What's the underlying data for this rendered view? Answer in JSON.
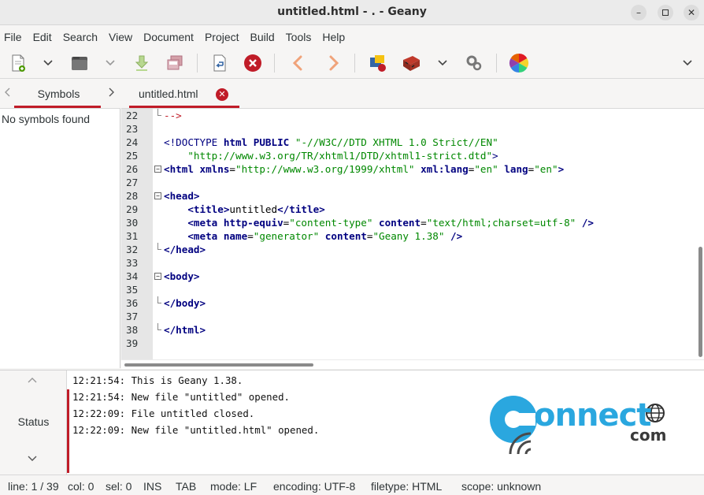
{
  "window": {
    "title": "untitled.html - . - Geany"
  },
  "menu": [
    "File",
    "Edit",
    "Search",
    "View",
    "Document",
    "Project",
    "Build",
    "Tools",
    "Help"
  ],
  "sidebar": {
    "tab_label": "Symbols",
    "empty_text": "No symbols found"
  },
  "editor": {
    "tab_label": "untitled.html",
    "lines": [
      {
        "n": "22",
        "parts": [
          {
            "c": "t-cmt",
            "t": "-->"
          }
        ],
        "fold": "end"
      },
      {
        "n": "23",
        "parts": []
      },
      {
        "n": "24",
        "parts": [
          {
            "c": "t-doc",
            "t": "<!DOCTYPE "
          },
          {
            "c": "t-attr",
            "t": "html"
          },
          {
            "c": "t-txt",
            "t": " "
          },
          {
            "c": "t-attr",
            "t": "PUBLIC"
          },
          {
            "c": "t-txt",
            "t": " "
          },
          {
            "c": "t-str",
            "t": "\"-//W3C//DTD XHTML 1.0 Strict//EN\""
          }
        ]
      },
      {
        "n": "25",
        "parts": [
          {
            "c": "t-txt",
            "t": "    "
          },
          {
            "c": "t-str",
            "t": "\"http://www.w3.org/TR/xhtml1/DTD/xhtml1-strict.dtd\""
          },
          {
            "c": "t-doc",
            "t": ">"
          }
        ]
      },
      {
        "n": "26",
        "parts": [
          {
            "c": "t-tag",
            "t": "<html "
          },
          {
            "c": "t-attr",
            "t": "xmlns"
          },
          {
            "c": "t-txt",
            "t": "="
          },
          {
            "c": "t-str",
            "t": "\"http://www.w3.org/1999/xhtml\""
          },
          {
            "c": "t-txt",
            "t": " "
          },
          {
            "c": "t-attr",
            "t": "xml:lang"
          },
          {
            "c": "t-txt",
            "t": "="
          },
          {
            "c": "t-str",
            "t": "\"en\""
          },
          {
            "c": "t-txt",
            "t": " "
          },
          {
            "c": "t-attr",
            "t": "lang"
          },
          {
            "c": "t-txt",
            "t": "="
          },
          {
            "c": "t-str",
            "t": "\"en\""
          },
          {
            "c": "t-tag",
            "t": ">"
          }
        ],
        "fold": "open"
      },
      {
        "n": "27",
        "parts": []
      },
      {
        "n": "28",
        "parts": [
          {
            "c": "t-tag",
            "t": "<head>"
          }
        ],
        "fold": "open"
      },
      {
        "n": "29",
        "parts": [
          {
            "c": "t-txt",
            "t": "    "
          },
          {
            "c": "t-tag",
            "t": "<title>"
          },
          {
            "c": "t-txt",
            "t": "untitled"
          },
          {
            "c": "t-tag",
            "t": "</title>"
          }
        ]
      },
      {
        "n": "30",
        "parts": [
          {
            "c": "t-txt",
            "t": "    "
          },
          {
            "c": "t-tag",
            "t": "<meta "
          },
          {
            "c": "t-attr",
            "t": "http-equiv"
          },
          {
            "c": "t-txt",
            "t": "="
          },
          {
            "c": "t-str",
            "t": "\"content-type\""
          },
          {
            "c": "t-txt",
            "t": " "
          },
          {
            "c": "t-attr",
            "t": "content"
          },
          {
            "c": "t-txt",
            "t": "="
          },
          {
            "c": "t-str",
            "t": "\"text/html;charset=utf-8\""
          },
          {
            "c": "t-txt",
            "t": " "
          },
          {
            "c": "t-tag",
            "t": "/>"
          }
        ]
      },
      {
        "n": "31",
        "parts": [
          {
            "c": "t-txt",
            "t": "    "
          },
          {
            "c": "t-tag",
            "t": "<meta "
          },
          {
            "c": "t-attr",
            "t": "name"
          },
          {
            "c": "t-txt",
            "t": "="
          },
          {
            "c": "t-str",
            "t": "\"generator\""
          },
          {
            "c": "t-txt",
            "t": " "
          },
          {
            "c": "t-attr",
            "t": "content"
          },
          {
            "c": "t-txt",
            "t": "="
          },
          {
            "c": "t-str",
            "t": "\"Geany 1.38\""
          },
          {
            "c": "t-txt",
            "t": " "
          },
          {
            "c": "t-tag",
            "t": "/>"
          }
        ]
      },
      {
        "n": "32",
        "parts": [
          {
            "c": "t-tag",
            "t": "</head>"
          }
        ],
        "fold": "end"
      },
      {
        "n": "33",
        "parts": []
      },
      {
        "n": "34",
        "parts": [
          {
            "c": "t-tag",
            "t": "<body>"
          }
        ],
        "fold": "open"
      },
      {
        "n": "35",
        "parts": []
      },
      {
        "n": "36",
        "parts": [
          {
            "c": "t-tag",
            "t": "</body>"
          }
        ],
        "fold": "end"
      },
      {
        "n": "37",
        "parts": []
      },
      {
        "n": "38",
        "parts": [
          {
            "c": "t-tag",
            "t": "</html>"
          }
        ],
        "fold": "end"
      },
      {
        "n": "39",
        "parts": []
      }
    ]
  },
  "messages": {
    "tab_label": "Status",
    "lines": [
      "12:21:54: This is Geany 1.38.",
      "12:21:54: New file \"untitled\" opened.",
      "12:22:09: File untitled closed.",
      "12:22:09: New file \"untitled.html\" opened."
    ]
  },
  "watermark": {
    "main": "onnect",
    "sub": "com"
  },
  "statusbar": {
    "line": "line: 1 / 39",
    "col": "col: 0",
    "sel": "sel: 0",
    "ins": "INS",
    "tab": "TAB",
    "mode": "mode: LF",
    "encoding": "encoding: UTF-8",
    "filetype": "filetype: HTML",
    "scope": "scope: unknown"
  },
  "colors": {
    "accent": "#c01c28",
    "tag": "#000080",
    "string": "#008800",
    "logo": "#2aa7df"
  },
  "icons": [
    "new-file-icon",
    "open-file-icon",
    "save-icon",
    "save-all-icon",
    "revert-icon",
    "close-icon",
    "back-icon",
    "forward-icon",
    "compile-icon",
    "build-icon",
    "run-icon",
    "color-chooser-icon"
  ]
}
